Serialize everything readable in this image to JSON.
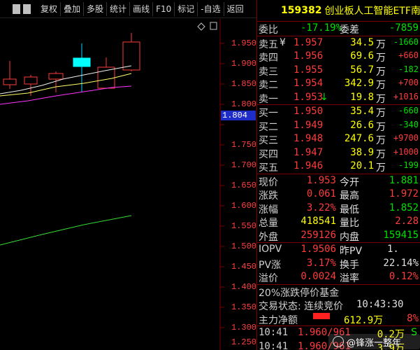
{
  "toolbar": {
    "items": [
      "复权",
      "叠加",
      "多股",
      "统计",
      "画线",
      "F10",
      "标记",
      "-自选",
      "返回"
    ]
  },
  "chart": {
    "price_axis": [
      "1.950",
      "1.900",
      "1.850",
      "1.800",
      "1.750",
      "1.700",
      "1.650",
      "1.600",
      "1.550",
      "1.500",
      "1.450",
      "1.400",
      "1.350",
      "1.300",
      "1.250"
    ],
    "current_price_tag": "1.804"
  },
  "quote": {
    "code": "159382",
    "name": "创业板人工智能ETF南",
    "weibi_label": "委比",
    "weibi": "-17.19%",
    "weicha_label": "委差",
    "weicha": "-7859",
    "asks": [
      {
        "label": "卖五",
        "mark": "¥",
        "price": "1.957",
        "vol": "34.5",
        "unit": "万",
        "chg": "-1660"
      },
      {
        "label": "卖四",
        "mark": "",
        "price": "1.956",
        "vol": "69.6",
        "unit": "万",
        "chg": "+660"
      },
      {
        "label": "卖三",
        "mark": "",
        "price": "1.955",
        "vol": "56.7",
        "unit": "万",
        "chg": "-182"
      },
      {
        "label": "卖二",
        "mark": "",
        "price": "1.954",
        "vol": "342.9",
        "unit": "万",
        "chg": "+700"
      },
      {
        "label": "卖一",
        "mark": "↓",
        "price": "1.953",
        "vol": "19.8",
        "unit": "万",
        "chg": "+1016"
      }
    ],
    "bids": [
      {
        "label": "买一",
        "price": "1.950",
        "vol": "35.4",
        "unit": "万",
        "chg": "-660"
      },
      {
        "label": "买二",
        "price": "1.949",
        "vol": "26.6",
        "unit": "万",
        "chg": "-340"
      },
      {
        "label": "买三",
        "price": "1.948",
        "vol": "247.6",
        "unit": "万",
        "chg": "+9700"
      },
      {
        "label": "买四",
        "price": "1.947",
        "vol": "38.9",
        "unit": "万",
        "chg": "+1000"
      },
      {
        "label": "买五",
        "price": "1.946",
        "vol": "20.1",
        "unit": "万",
        "chg": "-199"
      }
    ],
    "stats": [
      {
        "l1": "现价",
        "v1": "1.953",
        "l2": "今开",
        "v2": "1.881"
      },
      {
        "l1": "涨跌",
        "v1": "0.061",
        "l2": "最高",
        "v2": "1.972"
      },
      {
        "l1": "涨幅",
        "v1": "3.22%",
        "l2": "最低",
        "v2": "1.852"
      },
      {
        "l1": "总量",
        "v1": "418541",
        "l2": "量比",
        "v2": "2.28"
      },
      {
        "l1": "外盘",
        "v1": "259126",
        "l2": "内盘",
        "v2": "159415"
      }
    ],
    "iopv": [
      {
        "l1": "IOPV",
        "v1": "1.9506",
        "l2": "昨PV",
        "v2": "1."
      },
      {
        "l1": "PV涨",
        "v1": "3.17%",
        "l2": "换手",
        "v2": "22.14%"
      },
      {
        "l1": "溢价",
        "v1": "0.0024",
        "l2": "溢率",
        "v2": "0.12%"
      }
    ],
    "fund_note": "20%涨跌停价基金",
    "trade_status": "交易状态: 连续竞价",
    "trade_time": "10:43:30",
    "net_label": "主力净额",
    "net_value": "612.9万",
    "net_pct": "8%",
    "ticks": [
      {
        "time": "10:41",
        "price": "1.960/961",
        "vol": "0.2万",
        "suffix": "S"
      },
      {
        "time": "10:41",
        "price": "1.960/961",
        "vol": "3.9万",
        "suffix": ""
      }
    ]
  },
  "watermark": "@锋涨一整年",
  "colors": {
    "up": "#ff3c3c",
    "down": "#00e000",
    "accent": "#ffff00",
    "panel_border": "#7a0000"
  }
}
